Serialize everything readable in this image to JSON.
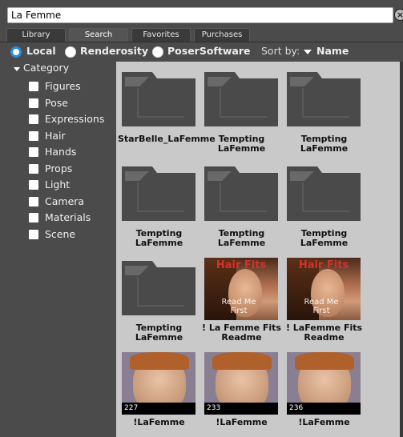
{
  "search": {
    "value": "La Femme"
  },
  "tabs": [
    {
      "label": "Library",
      "active": false
    },
    {
      "label": "Search",
      "active": true
    },
    {
      "label": "Favorites",
      "active": false
    },
    {
      "label": "Purchases",
      "active": false
    }
  ],
  "sources": [
    {
      "label": "Local",
      "selected": true
    },
    {
      "label": "Renderosity",
      "selected": false
    },
    {
      "label": "PoserSoftware",
      "selected": false
    }
  ],
  "sort": {
    "label": "Sort by:",
    "value": "Name"
  },
  "category": {
    "title": "Category",
    "items": [
      "Figures",
      "Pose",
      "Expressions",
      "Hair",
      "Hands",
      "Props",
      "Light",
      "Camera",
      "Materials",
      "Scene"
    ]
  },
  "results": [
    {
      "label": "StarBelle_LaFemme",
      "kind": "folder-icon"
    },
    {
      "label": "Tempting LaFemme",
      "kind": "folder-icon"
    },
    {
      "label": "Tempting LaFemme",
      "kind": "folder-icon"
    },
    {
      "label": "Tempting LaFemme",
      "kind": "folder-icon"
    },
    {
      "label": "Tempting LaFemme",
      "kind": "folder-icon"
    },
    {
      "label": "Tempting LaFemme",
      "kind": "folder-icon"
    },
    {
      "label": "Tempting LaFemme",
      "kind": "folder-icon"
    },
    {
      "label": "! La Femme Fits Readme",
      "kind": "readme-thumbnail",
      "overlay_top": "Hair Fits",
      "overlay_bottom": "Read Me First"
    },
    {
      "label": "! LaFemme Fits Readme",
      "kind": "readme-thumbnail",
      "overlay_top": "Hair Fits",
      "overlay_bottom": "Read Me First"
    },
    {
      "label": "!LaFemme",
      "kind": "face-thumbnail",
      "badge": "227"
    },
    {
      "label": "!LaFemme",
      "kind": "face-thumbnail",
      "badge": "233"
    },
    {
      "label": "!LaFemme",
      "kind": "face-thumbnail",
      "badge": "236"
    }
  ],
  "colors": {
    "panel": "#4b4b4b",
    "grid": "#c9c9c9",
    "folder": "#4a4a4a",
    "radio_accent": "#2e8ce0",
    "overlay_red": "#d4322c"
  }
}
